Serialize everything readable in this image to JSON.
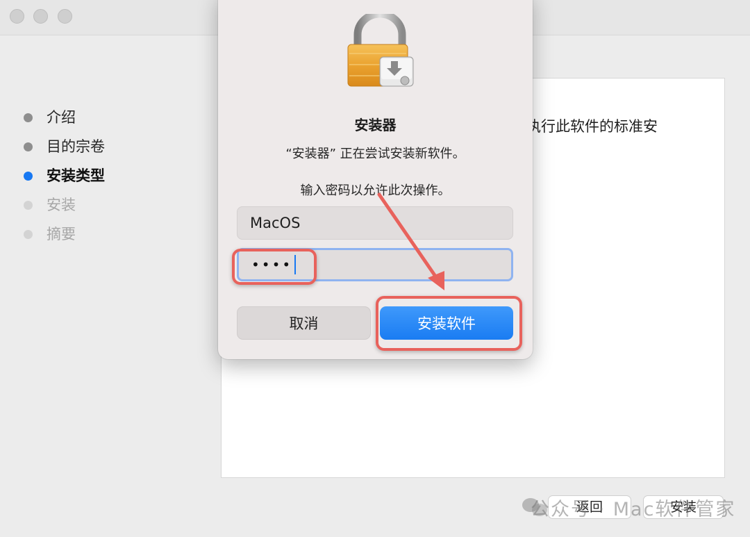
{
  "sidebar": {
    "steps": [
      {
        "label": "介绍",
        "state": "done"
      },
      {
        "label": "目的宗卷",
        "state": "done"
      },
      {
        "label": "安装类型",
        "state": "active"
      },
      {
        "label": "安装",
        "state": "pending"
      },
      {
        "label": "摘要",
        "state": "pending"
      }
    ]
  },
  "main": {
    "body_text": "执行此软件的标准安"
  },
  "footer": {
    "back_label": "返回",
    "install_label": "安装"
  },
  "dialog": {
    "title": "安装器",
    "message": "“安装器” 正在尝试安装新软件。",
    "prompt": "输入密码以允许此次操作。",
    "username": "MacOS",
    "password_mask": "••••",
    "cancel_label": "取消",
    "confirm_label": "安装软件"
  },
  "watermark": {
    "text": "公众号 · Mac软件管家"
  },
  "colors": {
    "accent": "#1778f2",
    "annotation": "#e8625c",
    "window_bg": "#ececec",
    "dialog_bg": "#eeeaea"
  },
  "icons": [
    "lock-icon",
    "installer-disk-icon",
    "wechat-icon",
    "annotation-arrow"
  ]
}
